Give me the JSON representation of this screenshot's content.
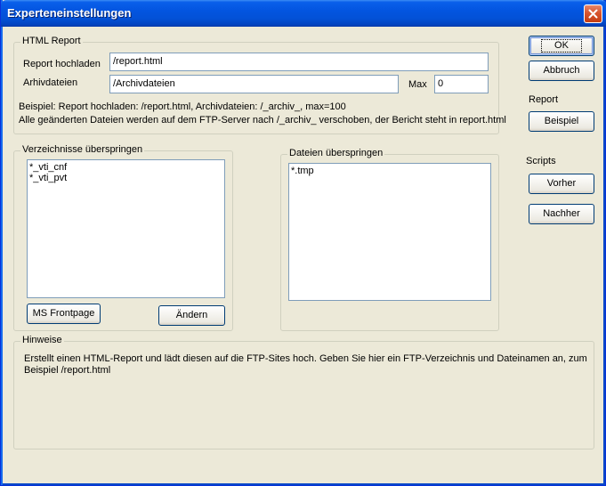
{
  "window": {
    "title": "Experteneinstellungen"
  },
  "html_report": {
    "group_label": "HTML Report",
    "upload_label": "Report hochladen",
    "upload_value": "/report.html",
    "archive_label": "Arhivdateien",
    "archive_value": "/Archivdateien",
    "max_label": "Max",
    "max_value": "0",
    "example_line1": "Beispiel: Report hochladen: /report.html, Archivdateien: /_archiv_, max=100",
    "example_line2": "Alle geänderten Dateien werden auf dem FTP-Server nach /_archiv_ verschoben, der Bericht steht in report.html"
  },
  "skip_dirs": {
    "group_label": "Verzeichnisse überspringen",
    "items": [
      "*_vti_cnf",
      "*_vti_pvt"
    ],
    "frontpage_button": "MS Frontpage",
    "change_button": "Ändern"
  },
  "skip_files": {
    "group_label": "Dateien überspringen",
    "items": [
      "*.tmp"
    ]
  },
  "hints": {
    "group_label": "Hinweise",
    "line1": "Erstellt einen HTML-Report und lädt diesen auf die FTP-Sites hoch. Geben Sie hier ein FTP-Verzeichnis und Dateinamen an, zum",
    "line2": "Beispiel /report.html"
  },
  "side": {
    "ok_button": "OK",
    "cancel_button": "Abbruch",
    "report_label": "Report",
    "example_button": "Beispiel",
    "scripts_label": "Scripts",
    "before_button": "Vorher",
    "after_button": "Nachher"
  }
}
